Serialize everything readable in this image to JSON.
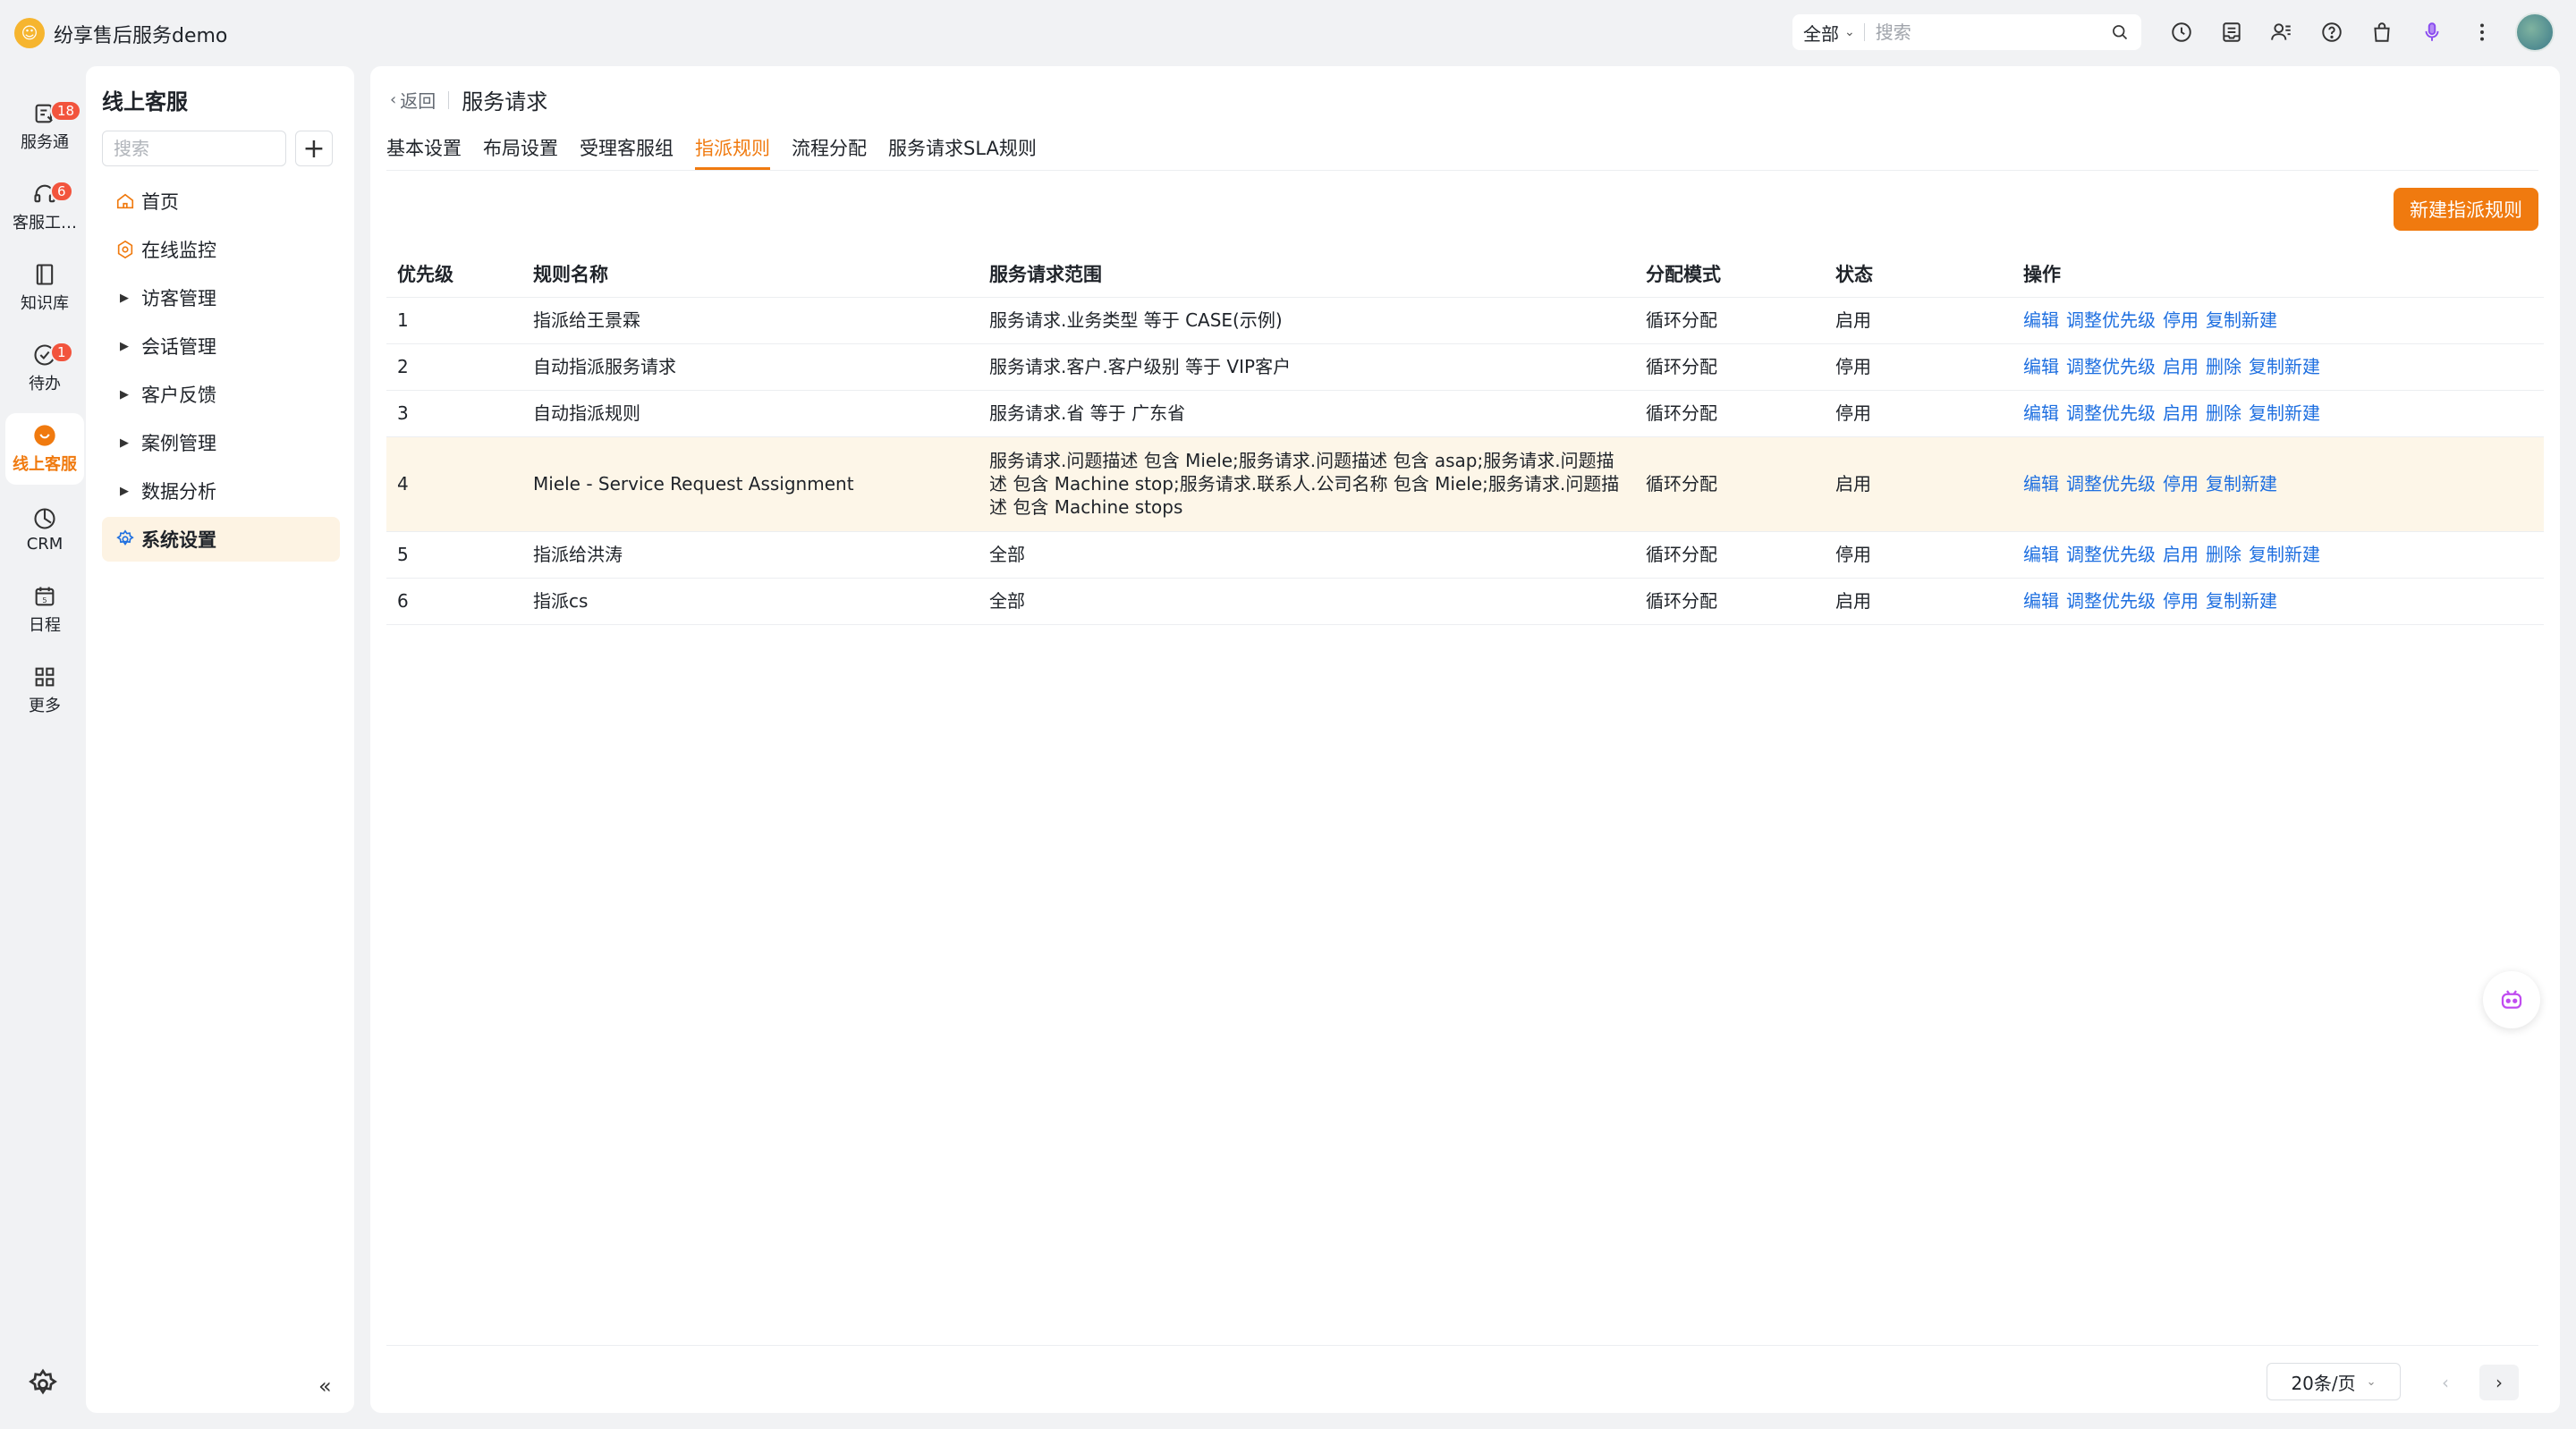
{
  "app": {
    "title": "纷享售后服务demo"
  },
  "topbar": {
    "scope": "全部",
    "search_placeholder": "搜索",
    "icons": [
      "clock-icon",
      "inbox-icon",
      "contacts-icon",
      "help-icon",
      "shopping-bag-icon",
      "microphone-icon",
      "more-vertical-icon"
    ]
  },
  "rail": {
    "items": [
      {
        "label": "服务通",
        "icon": "service-icon",
        "badge": "18"
      },
      {
        "label": "客服工…",
        "icon": "headset-icon",
        "badge": "6"
      },
      {
        "label": "知识库",
        "icon": "book-icon",
        "badge": ""
      },
      {
        "label": "待办",
        "icon": "check-circle-icon",
        "badge": "1"
      },
      {
        "label": "线上客服",
        "icon": "chat-icon",
        "badge": ""
      },
      {
        "label": "CRM",
        "icon": "crm-icon",
        "badge": ""
      },
      {
        "label": "日程",
        "icon": "calendar-icon",
        "badge": ""
      },
      {
        "label": "更多",
        "icon": "grid-icon",
        "badge": ""
      }
    ],
    "active": "线上客服"
  },
  "sidenav": {
    "title": "线上客服",
    "search_placeholder": "搜索",
    "add_label": "+",
    "items": [
      {
        "label": "首页",
        "icon": "home-icon"
      },
      {
        "label": "在线监控",
        "icon": "monitor-icon"
      },
      {
        "label": "访客管理",
        "icon": "caret-right-icon"
      },
      {
        "label": "会话管理",
        "icon": "caret-right-icon"
      },
      {
        "label": "客户反馈",
        "icon": "caret-right-icon"
      },
      {
        "label": "案例管理",
        "icon": "caret-right-icon"
      },
      {
        "label": "数据分析",
        "icon": "caret-right-icon"
      },
      {
        "label": "系统设置",
        "icon": "gear-icon"
      }
    ],
    "collapse": "«"
  },
  "main": {
    "back_label": "返回",
    "page_title": "服务请求",
    "tabs": [
      "基本设置",
      "布局设置",
      "受理客服组",
      "指派规则",
      "流程分配",
      "服务请求SLA规则"
    ],
    "active_tab": "指派规则",
    "new_button": "新建指派规则",
    "table": {
      "headers": [
        "优先级",
        "规则名称",
        "服务请求范围",
        "分配模式",
        "状态",
        "操作"
      ],
      "rows": [
        {
          "priority": "1",
          "name": "指派给王景霖",
          "scope": "服务请求.业务类型 等于 CASE(示例)",
          "mode": "循环分配",
          "status": "启用",
          "ops": [
            "编辑",
            "调整优先级",
            "停用",
            "复制新建"
          ]
        },
        {
          "priority": "2",
          "name": "自动指派服务请求",
          "scope": "服务请求.客户.客户级别 等于 VIP客户",
          "mode": "循环分配",
          "status": "停用",
          "ops": [
            "编辑",
            "调整优先级",
            "启用",
            "删除",
            "复制新建"
          ]
        },
        {
          "priority": "3",
          "name": "自动指派规则",
          "scope": "服务请求.省 等于 广东省",
          "mode": "循环分配",
          "status": "停用",
          "ops": [
            "编辑",
            "调整优先级",
            "启用",
            "删除",
            "复制新建"
          ]
        },
        {
          "priority": "4",
          "name": "Miele - Service Request Assignment",
          "scope": "服务请求.问题描述 包含 Miele;服务请求.问题描述 包含 asap;服务请求.问题描述 包含 Machine stop;服务请求.联系人.公司名称 包含 Miele;服务请求.问题描述 包含 Machine stops",
          "mode": "循环分配",
          "status": "启用",
          "ops": [
            "编辑",
            "调整优先级",
            "停用",
            "复制新建"
          ]
        },
        {
          "priority": "5",
          "name": "指派给洪涛",
          "scope": "全部",
          "mode": "循环分配",
          "status": "停用",
          "ops": [
            "编辑",
            "调整优先级",
            "启用",
            "删除",
            "复制新建"
          ]
        },
        {
          "priority": "6",
          "name": "指派cs",
          "scope": "全部",
          "mode": "循环分配",
          "status": "启用",
          "ops": [
            "编辑",
            "调整优先级",
            "停用",
            "复制新建"
          ]
        }
      ]
    },
    "pagination": {
      "page_size": "20条/页",
      "prev": "‹",
      "next": "›"
    }
  },
  "colors": {
    "accent": "#f07a0f",
    "link": "#1e6fe0",
    "badge": "#f2543d",
    "highlight_row": "#fdf6e8"
  }
}
